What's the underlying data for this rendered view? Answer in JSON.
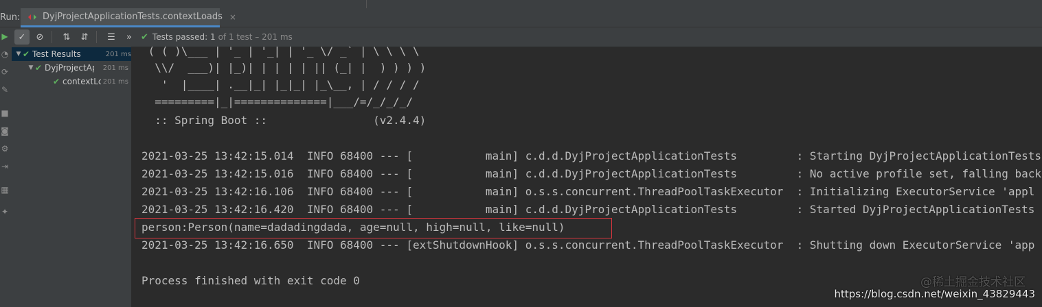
{
  "header": {
    "run_label": "Run:",
    "tab_title": "DyjProjectApplicationTests.contextLoads",
    "tab_close": "×"
  },
  "toolbar": {
    "run_icon": "▶",
    "show_passed_icon": "✓",
    "show_ignored_icon": "⊘",
    "sort_alpha_icon": "⇅",
    "sort_duration_icon": "⇵",
    "expand_icon": "☰",
    "more_icon": "»",
    "status_check": "✔",
    "status_prefix": "Tests passed:",
    "status_count": "1",
    "status_detail": "of 1 test – 201 ms"
  },
  "tree": {
    "items": [
      {
        "label": "Test Results",
        "time": "201 ms"
      },
      {
        "label": "DyjProjectAp",
        "time": "201 ms"
      },
      {
        "label": "contextLc",
        "time": "201 ms"
      }
    ]
  },
  "console": {
    "lines": [
      " ( ( )\\___ | '_ | '_| | '_ \\/ _` | \\ \\ \\ \\",
      "  \\\\/  ___)| |_)| | | | | || (_| |  ) ) ) )",
      "   '  |____| .__|_| |_|_| |_\\__, | / / / /",
      "  =========|_|==============|___/=/_/_/_/",
      "  :: Spring Boot ::                (v2.4.4)",
      "",
      "2021-03-25 13:42:15.014  INFO 68400 --- [           main] c.d.d.DyjProjectApplicationTests         : Starting DyjProjectApplicationTests",
      "2021-03-25 13:42:15.016  INFO 68400 --- [           main] c.d.d.DyjProjectApplicationTests         : No active profile set, falling back",
      "2021-03-25 13:42:16.106  INFO 68400 --- [           main] o.s.s.concurrent.ThreadPoolTaskExecutor  : Initializing ExecutorService 'appl",
      "2021-03-25 13:42:16.420  INFO 68400 --- [           main] c.d.d.DyjProjectApplicationTests         : Started DyjProjectApplicationTests",
      "person:Person(name=dadadingdada, age=null, high=null, like=null)",
      "2021-03-25 13:42:16.650  INFO 68400 --- [extShutdownHook] o.s.s.concurrent.ThreadPoolTaskExecutor  : Shutting down ExecutorService 'app",
      "",
      "Process finished with exit code 0"
    ]
  },
  "watermark": {
    "cn": "@稀土掘金技术社区",
    "url": "https://blog.csdn.net/weixin_43829443"
  },
  "colors": {
    "pass_green": "#5fb25f",
    "highlight_red": "#d9363e",
    "selection": "#0d293e"
  }
}
